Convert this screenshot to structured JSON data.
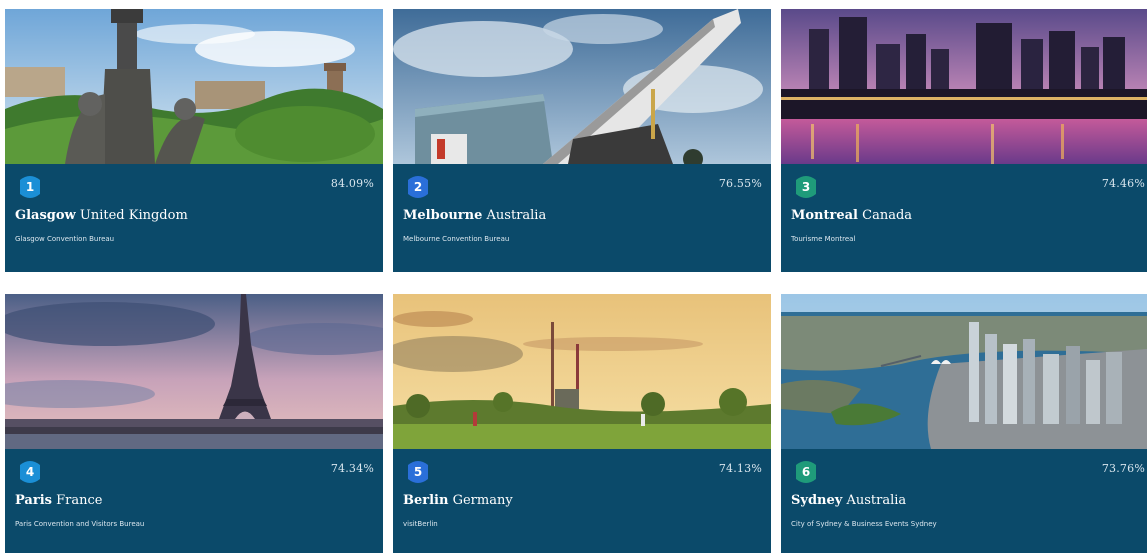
{
  "colors": {
    "card_background": "#0b4a6a",
    "badge_blue": "#1b8fd6",
    "badge_royal": "#2a6fd9",
    "badge_green": "#1f9b7a"
  },
  "cards": [
    {
      "rank": "1",
      "percent": "84.09%",
      "city": "Glasgow",
      "country": "United Kingdom",
      "organisation": "Glasgow Convention Bureau",
      "badge_color": "#1b8fd6",
      "image": "glasgow-photo"
    },
    {
      "rank": "2",
      "percent": "76.55%",
      "city": "Melbourne",
      "country": "Australia",
      "organisation": "Melbourne Convention Bureau",
      "badge_color": "#2a6fd9",
      "image": "melbourne-photo"
    },
    {
      "rank": "3",
      "percent": "74.46%",
      "city": "Montreal",
      "country": "Canada",
      "organisation": "Tourisme Montreal",
      "badge_color": "#1f9b7a",
      "image": "montreal-photo"
    },
    {
      "rank": "4",
      "percent": "74.34%",
      "city": "Paris",
      "country": "France",
      "organisation": "Paris Convention and Visitors Bureau",
      "badge_color": "#1b8fd6",
      "image": "paris-photo"
    },
    {
      "rank": "5",
      "percent": "74.13%",
      "city": "Berlin",
      "country": "Germany",
      "organisation": "visitBerlin",
      "badge_color": "#2a6fd9",
      "image": "berlin-photo"
    },
    {
      "rank": "6",
      "percent": "73.76%",
      "city": "Sydney",
      "country": "Australia",
      "organisation": "City of Sydney & Business Events Sydney",
      "badge_color": "#1f9b7a",
      "image": "sydney-photo"
    }
  ]
}
